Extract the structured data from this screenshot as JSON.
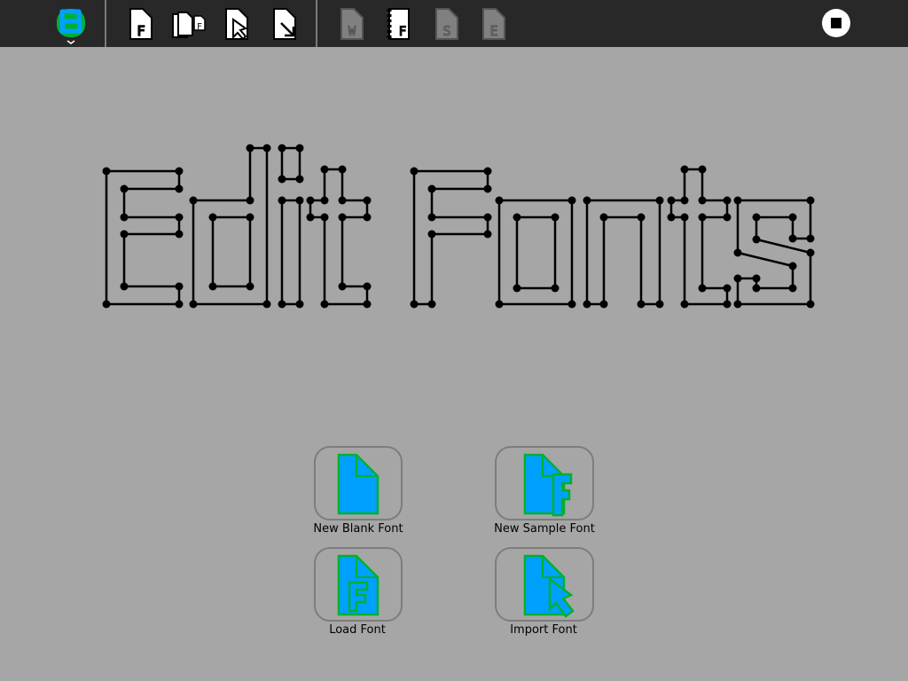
{
  "toolbar": {
    "activity_icon": "sugar-activity-icon",
    "buttons": [
      {
        "name": "new-font-icon",
        "letter": "F"
      },
      {
        "name": "new-sample-font-icon",
        "letter": "F"
      },
      {
        "name": "load-font-icon",
        "letter": ""
      },
      {
        "name": "import-font-icon",
        "letter": ""
      },
      {
        "name": "edit-glyph-icon",
        "letter": "W"
      },
      {
        "name": "sample-font-icon",
        "letter": "F"
      },
      {
        "name": "save-icon",
        "letter": "S"
      },
      {
        "name": "export-icon",
        "letter": "E"
      }
    ],
    "stop_icon": "stop-icon"
  },
  "hero": {
    "text": "Edit Fonts"
  },
  "actions": [
    {
      "name": "new-blank-font-button",
      "label": "New Blank Font",
      "icon": "blank-document-icon"
    },
    {
      "name": "new-sample-font-button",
      "label": "New Sample Font",
      "icon": "sample-font-document-icon"
    },
    {
      "name": "load-font-button",
      "label": "Load Font",
      "icon": "font-document-icon"
    },
    {
      "name": "import-font-button",
      "label": "Import Font",
      "icon": "import-document-icon"
    }
  ],
  "colors": {
    "toolbar_bg": "#282828",
    "canvas_bg": "#a6a6a6",
    "icon_fill": "#00a0ff",
    "icon_stroke": "#00b030"
  }
}
